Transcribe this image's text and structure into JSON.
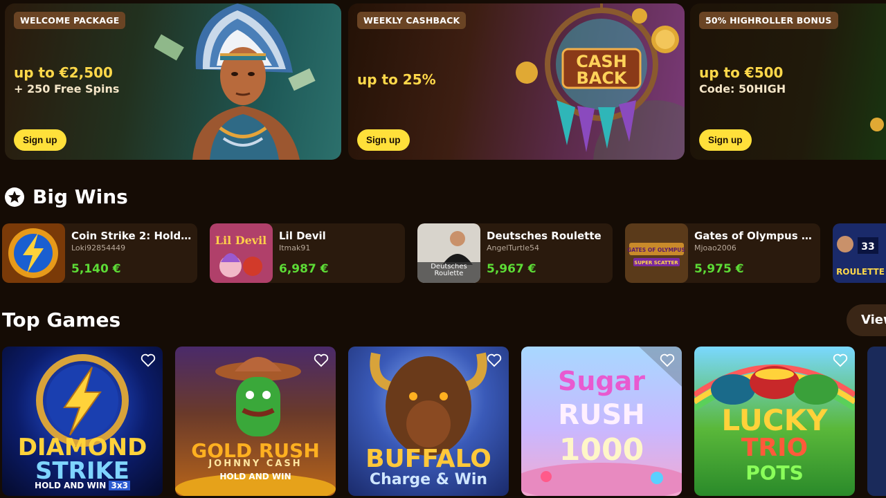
{
  "promos": [
    {
      "badge": "WELCOME PACKAGE",
      "headline": "up to €2,500",
      "subline": "+ 250 Free Spins",
      "button": "Sign up"
    },
    {
      "badge": "WEEKLY CASHBACK",
      "headline": "up to 25%",
      "subline": "",
      "button": "Sign up",
      "art_text_1": "CASH",
      "art_text_2": "BACK"
    },
    {
      "badge": "50% HIGHROLLER BONUS",
      "headline": "up to €500",
      "subline": "Code: 50HIGH",
      "button": "Sign up"
    }
  ],
  "big_wins": {
    "title": "Big Wins",
    "items": [
      {
        "game": "Coin Strike 2: Hold a...",
        "user": "Loki92854449",
        "amount": "5,140 €"
      },
      {
        "game": "Lil Devil",
        "user": "Itmak91",
        "amount": "6,987 €",
        "thumb_text": "Lil Devil"
      },
      {
        "game": "Deutsches Roulette",
        "user": "AngelTurtle54",
        "amount": "5,967 €",
        "thumb_text": "Deutsches Roulette"
      },
      {
        "game": "Gates of Olympus Su...",
        "user": "Mjoao2006",
        "amount": "5,975 €",
        "thumb_text_1": "GATES OF OLYMPUS",
        "thumb_text_2": "SUPER SCATTER"
      },
      {
        "game": "",
        "user": "",
        "amount": "",
        "thumb_text_1": "33",
        "thumb_text_2": "ROULETTE"
      }
    ]
  },
  "top_games": {
    "title": "Top Games",
    "view_label": "View",
    "items": [
      {
        "line1": "DIAMOND",
        "line2": "STRIKE",
        "line3": "HOLD AND WIN",
        "tag": "3x3"
      },
      {
        "line1": "GOLD RUSH",
        "line2": "JOHNNY CASH",
        "line3": "HOLD AND WIN"
      },
      {
        "line1": "BUFFALO",
        "line2": "Charge & Win"
      },
      {
        "line1": "Sugar",
        "line2": "RUSH",
        "line3": "1000"
      },
      {
        "line1": "LUCKY",
        "line2": "TRIO",
        "line3": "POTS"
      }
    ]
  },
  "colors": {
    "accent_yellow": "#ffe03a",
    "win_green": "#5ddc36",
    "badge_brown": "#6a4424",
    "bg": "#150c05"
  }
}
